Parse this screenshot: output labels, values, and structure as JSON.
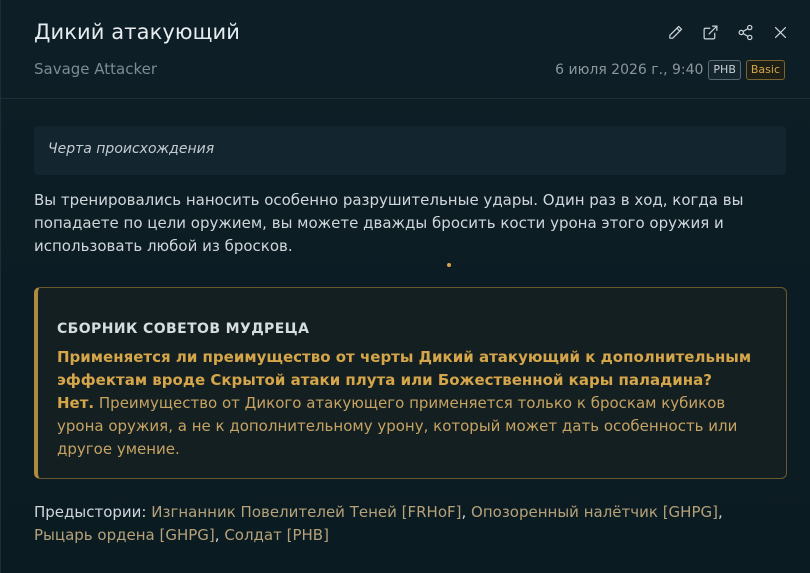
{
  "header": {
    "title": "Дикий атакующий",
    "subtitle": "Savage Attacker",
    "date": "6 июля 2026 г., 9:40",
    "source_badge": "PHB",
    "level_badge": "Basic",
    "tools": [
      "pencil-icon",
      "external-link-icon",
      "share-icon",
      "close-icon"
    ]
  },
  "origin": {
    "label": "Черта происхождения"
  },
  "description": "Вы тренировались наносить особенно разрушительные удары. Один раз в ход, когда вы попадаете по цели оружием, вы можете дважды бросить кости урона этого оружия и использовать любой из бросков.",
  "sage": {
    "title": "СБОРНИК СОВЕТОВ МУДРЕЦА",
    "question": "Применяется ли преимущество от черты Дикий атакующий к дополнительным эффектам вроде Скрытой атаки плута или Божественной кары паладина?",
    "answer_lead": "Нет.",
    "answer_body": " Преимущество от Дикого атакующего применяется только к броскам кубиков урона оружия, а не к дополнительному урону, который может дать особенность или другое умение."
  },
  "backgrounds": {
    "label": "Предыстории:",
    "items": [
      "Изгнанник Повелителей Теней [FRHoF]",
      "Опозоренный налётчик [GHPG]",
      "Рыцарь ордена [GHPG]",
      "Солдат [PHB]"
    ],
    "separator": ", "
  },
  "colors": {
    "background": "#0b1a21",
    "accent": "#d5a54a",
    "link": "#b5a27a"
  }
}
